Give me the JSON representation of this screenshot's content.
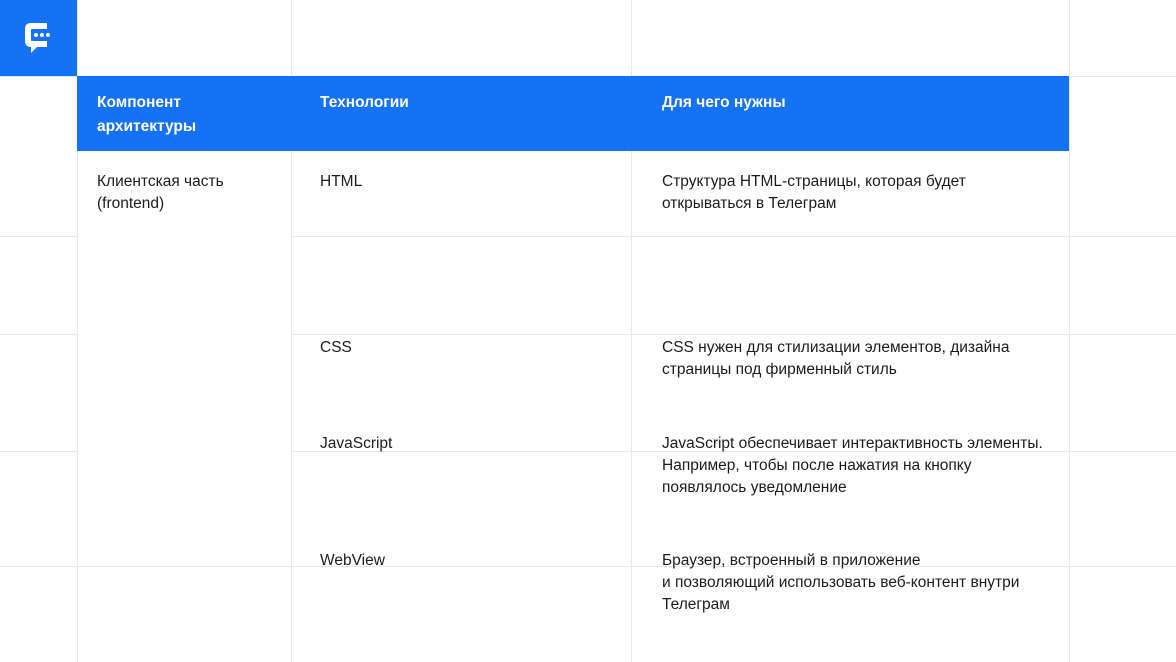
{
  "brand": {
    "color": "#1672f5",
    "logo_icon": "chat-bubble-logo-icon"
  },
  "table": {
    "headers": [
      "Компонент архитектуры",
      "Технологии",
      "Для чего нужны"
    ],
    "group_label": "Клиентская часть (frontend)",
    "rows": [
      {
        "tech": "HTML",
        "desc": "Структура HTML-страницы, которая будет\nоткрываться в Телеграм"
      },
      {
        "tech": "CSS",
        "desc": "CSS нужен для стилизации элементов, дизайна\nстраницы под фирменный стиль"
      },
      {
        "tech": "JavaScript",
        "desc": "JavaScript обеспечивает интерактивность элементы.\nНапример, чтобы после нажатия на кнопку\nпоявлялось уведомление"
      },
      {
        "tech": "WebView",
        "desc": "Браузер, встроенный в приложение\nи позволяющий использовать веб-контент внутри\nТелеграм"
      }
    ]
  }
}
